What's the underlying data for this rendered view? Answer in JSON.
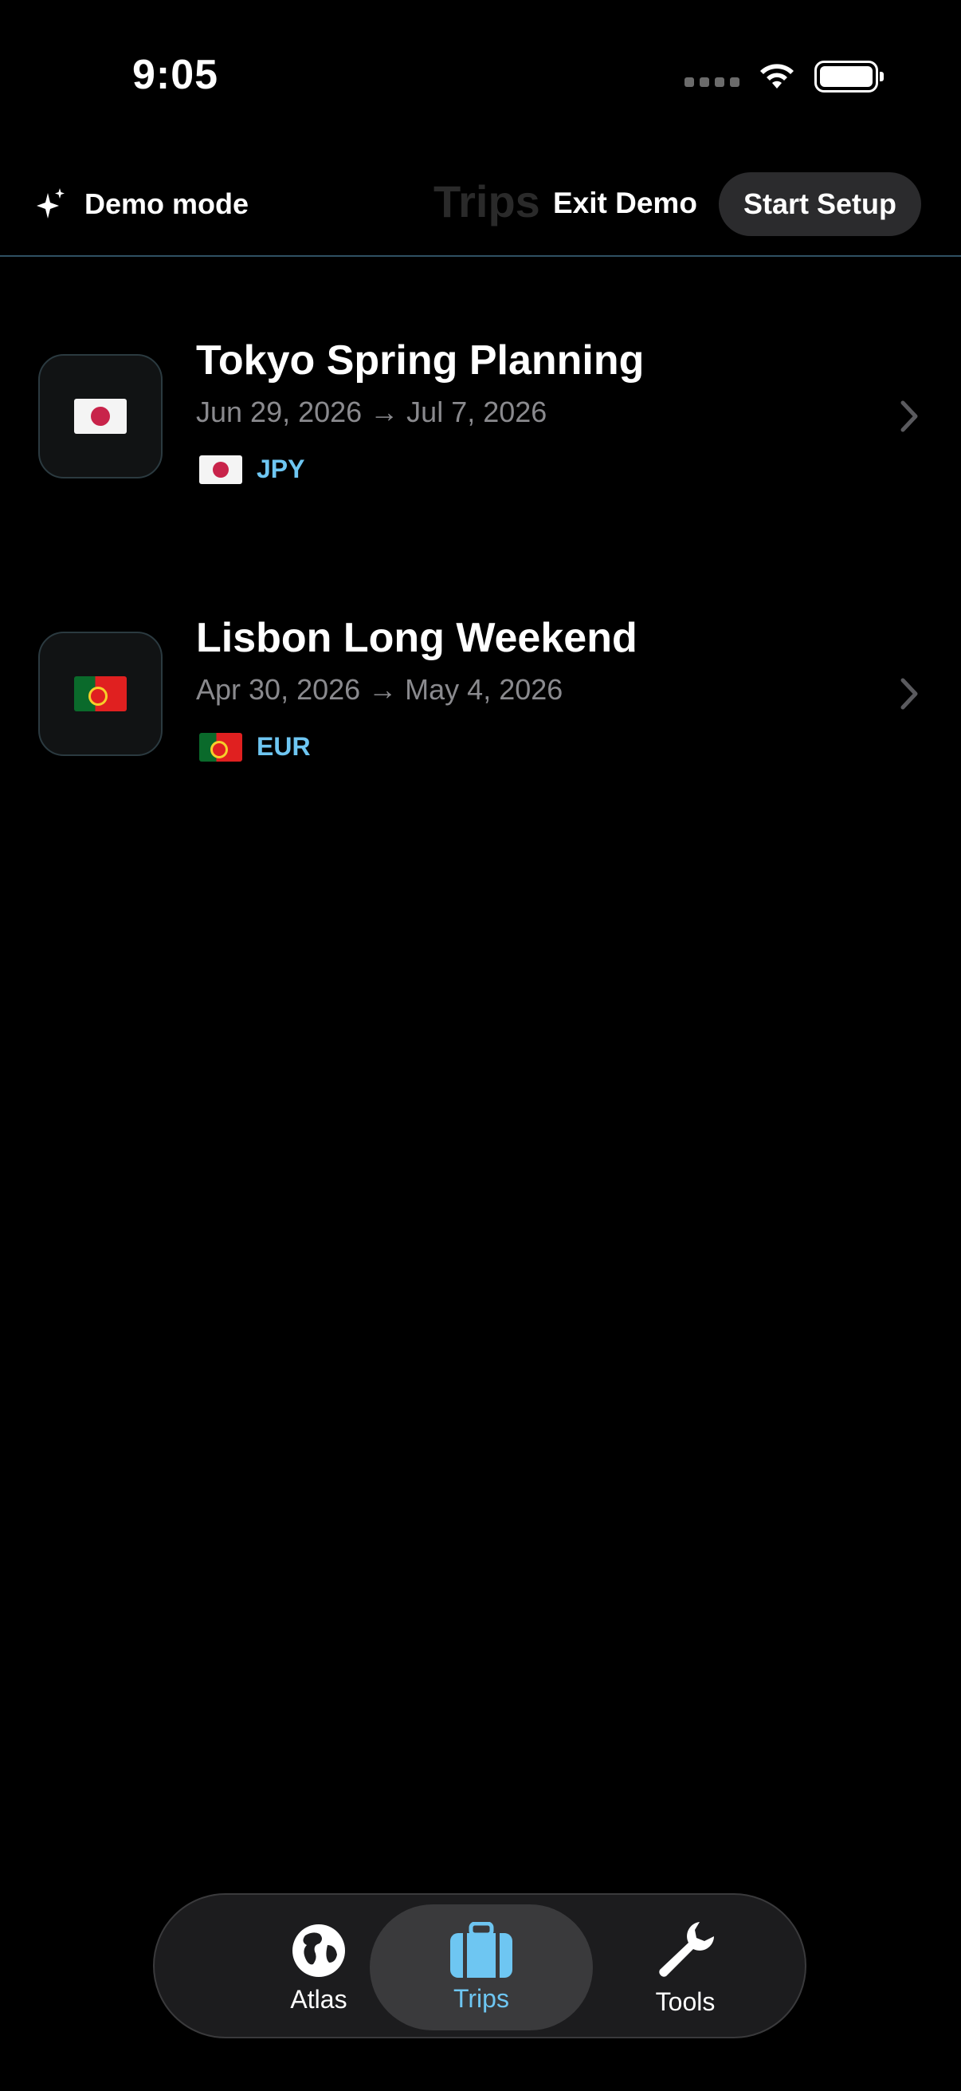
{
  "status_bar": {
    "time": "9:05"
  },
  "header": {
    "demo_mode_label": "Demo mode",
    "title": "Trips",
    "exit_demo_label": "Exit Demo",
    "start_setup_label": "Start Setup"
  },
  "trips": [
    {
      "title": "Tokyo Spring Planning",
      "dates": "Jun 29, 2026 → Jul 7, 2026",
      "currency": "JPY",
      "flag_icon": "japan-flag-icon"
    },
    {
      "title": "Lisbon Long Weekend",
      "dates": "Apr 30, 2026 → May 4, 2026",
      "currency": "EUR",
      "flag_icon": "portugal-flag-icon"
    }
  ],
  "tabbar": {
    "tabs": [
      {
        "label": "Atlas",
        "icon": "globe-icon",
        "active": false
      },
      {
        "label": "Trips",
        "icon": "suitcase-icon",
        "active": true
      },
      {
        "label": "Tools",
        "icon": "wrench-icon",
        "active": false
      }
    ]
  },
  "colors": {
    "accent": "#6ec6f2",
    "background": "#000000",
    "secondary_text": "#8a8a8e",
    "divider": "#2f5063"
  }
}
